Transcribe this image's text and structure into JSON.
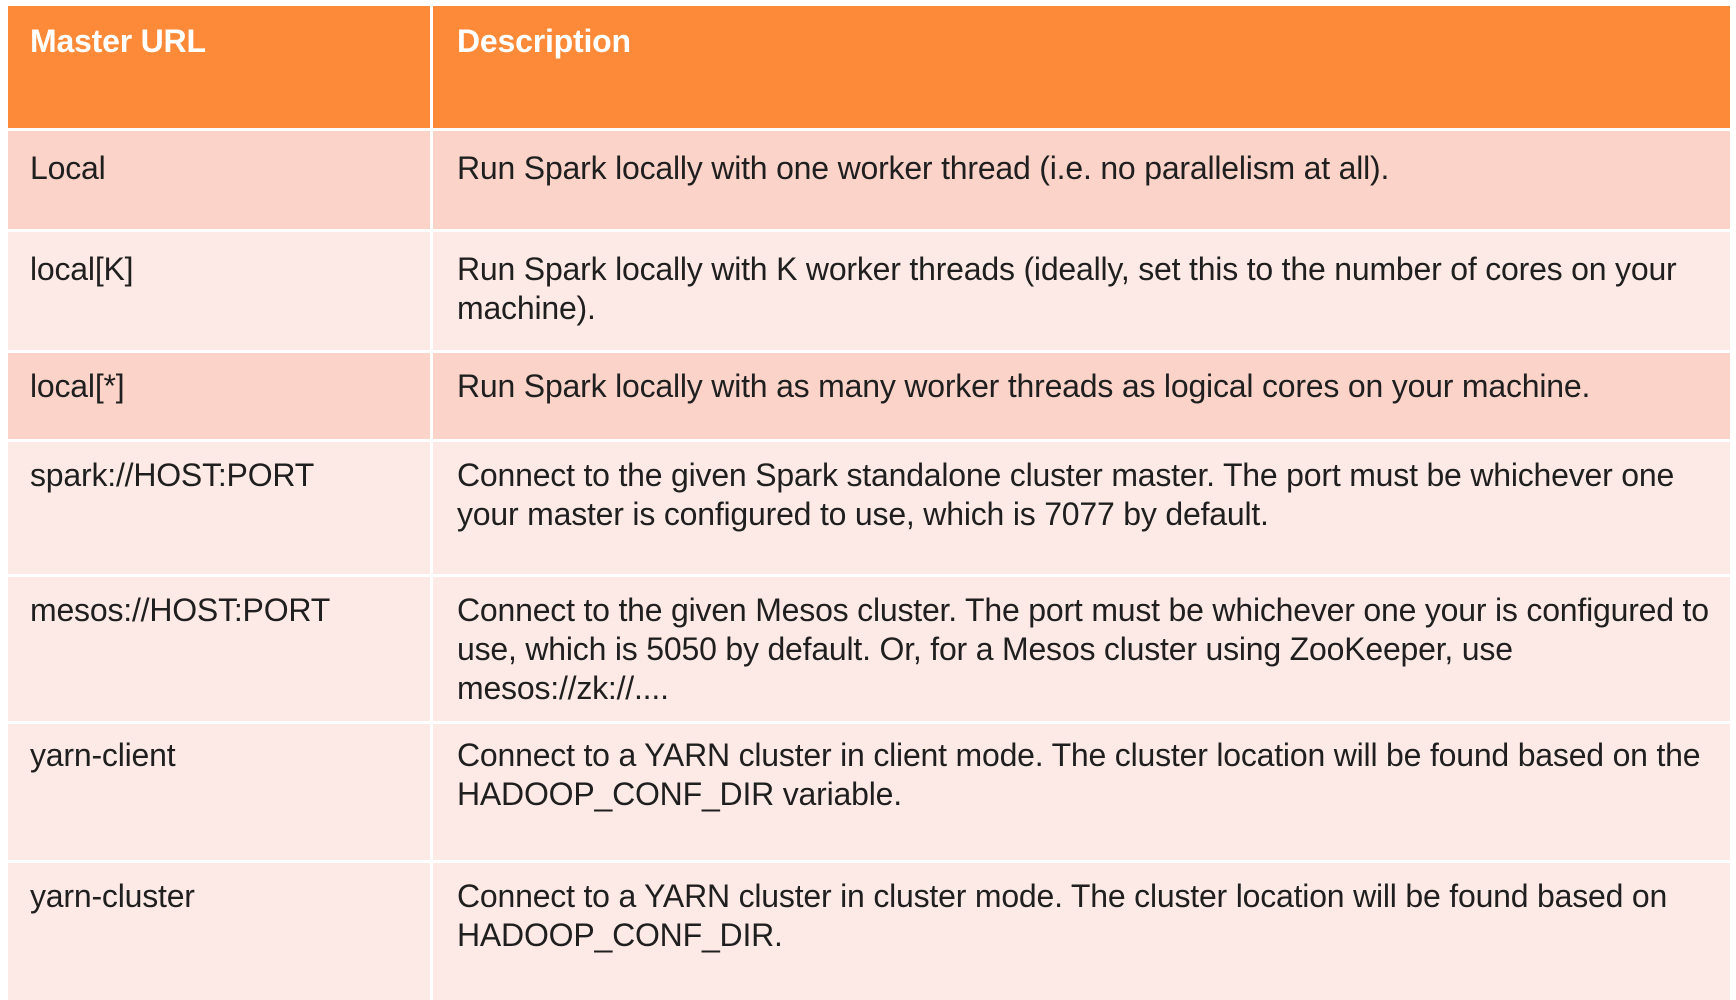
{
  "table": {
    "headers": [
      "Master URL",
      "Description"
    ],
    "rows": [
      {
        "url": "Local",
        "description": "Run Spark locally with one worker thread (i.e. no parallelism at all)."
      },
      {
        "url": "local[K]",
        "description": "Run Spark locally with K worker threads (ideally, set this to the number of cores on your machine)."
      },
      {
        "url": "local[*]",
        "description": "Run Spark locally with as many worker threads as logical cores on your machine."
      },
      {
        "url": "spark://HOST:PORT",
        "description": "Connect to the given Spark standalone cluster master. The port must be whichever one your master is configured to use, which is 7077 by default."
      },
      {
        "url": "mesos://HOST:PORT",
        "description": "Connect to the given Mesos cluster. The port must be whichever one your is configured to use, which is 5050 by default. Or, for a Mesos cluster using ZooKeeper, use mesos://zk://...."
      },
      {
        "url": "yarn-client",
        "description": "Connect to a YARN cluster in client mode. The cluster location will be found based on the HADOOP_CONF_DIR variable."
      },
      {
        "url": "yarn-cluster",
        "description": "Connect to a YARN cluster in cluster mode. The cluster location will be found based on HADOOP_CONF_DIR."
      }
    ]
  },
  "colors": {
    "header_bg": "#fd8a38",
    "row_dark": "#fbd3c9",
    "row_light": "#fde9e5",
    "header_text": "#ffffff",
    "body_text": "#1f1f1f"
  }
}
